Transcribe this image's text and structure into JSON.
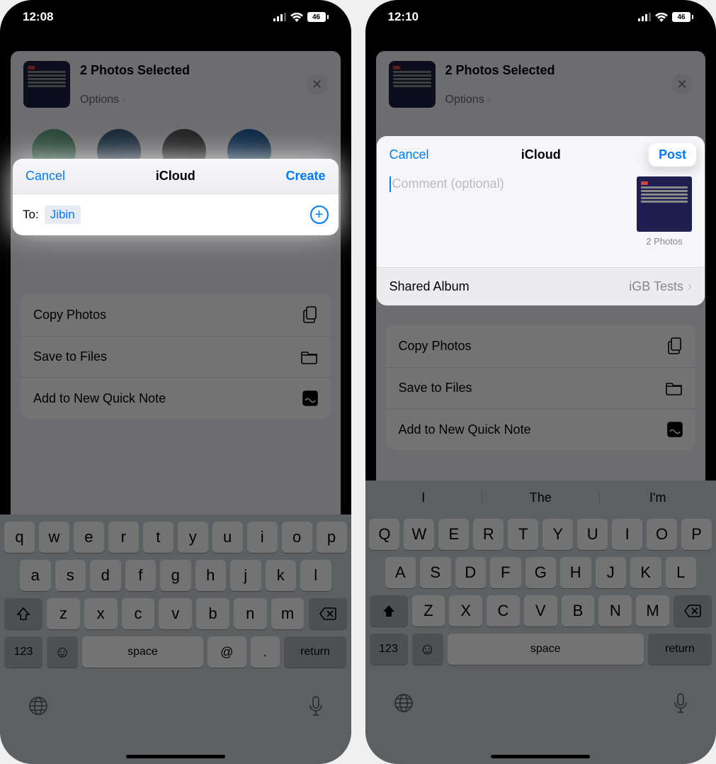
{
  "left": {
    "status": {
      "time": "12:08",
      "battery": "46"
    },
    "sheet": {
      "title": "2 Photos Selected",
      "options": "Options"
    },
    "actions": {
      "copy": "Copy Photos",
      "save": "Save to Files",
      "note": "Add to New Quick Note"
    },
    "dialog": {
      "cancel": "Cancel",
      "title": "iCloud",
      "create": "Create",
      "to_label": "To:",
      "recipient": "Jibin"
    },
    "keyboard": {
      "row1": [
        "q",
        "w",
        "e",
        "r",
        "t",
        "y",
        "u",
        "i",
        "o",
        "p"
      ],
      "row2": [
        "a",
        "s",
        "d",
        "f",
        "g",
        "h",
        "j",
        "k",
        "l"
      ],
      "row3": [
        "z",
        "x",
        "c",
        "v",
        "b",
        "n",
        "m"
      ],
      "num": "123",
      "space": "space",
      "at": "@",
      "dot": ".",
      "return": "return"
    }
  },
  "right": {
    "status": {
      "time": "12:10",
      "battery": "46"
    },
    "sheet": {
      "title": "2 Photos Selected",
      "options": "Options"
    },
    "actions": {
      "copy": "Copy Photos",
      "save": "Save to Files",
      "note": "Add to New Quick Note"
    },
    "dialog": {
      "cancel": "Cancel",
      "title": "iCloud",
      "post": "Post",
      "placeholder": "Comment (optional)",
      "count": "2 Photos",
      "shared_label": "Shared Album",
      "shared_value": "iGB Tests"
    },
    "suggestions": {
      "s1": "I",
      "s2": "The",
      "s3": "I'm"
    },
    "keyboard": {
      "row1": [
        "Q",
        "W",
        "E",
        "R",
        "T",
        "Y",
        "U",
        "I",
        "O",
        "P"
      ],
      "row2": [
        "A",
        "S",
        "D",
        "F",
        "G",
        "H",
        "J",
        "K",
        "L"
      ],
      "row3": [
        "Z",
        "X",
        "C",
        "V",
        "B",
        "N",
        "M"
      ],
      "num": "123",
      "space": "space",
      "return": "return"
    }
  }
}
